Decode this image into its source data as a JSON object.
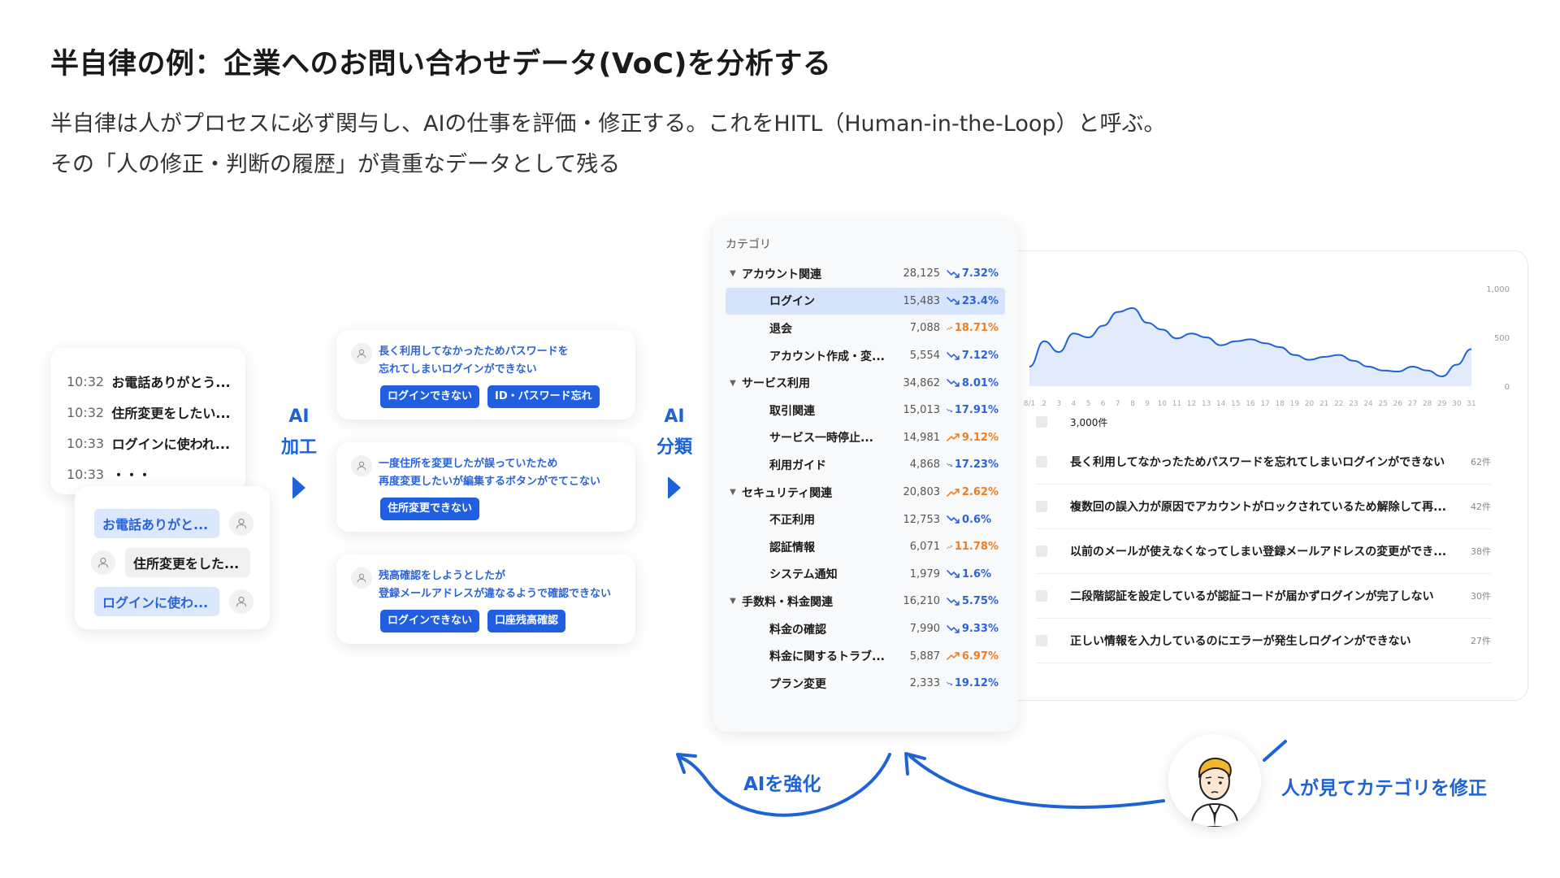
{
  "title": "半自律の例：企業へのお問い合わせデータ(VoC)を分析する",
  "subtitle_lines": [
    "半自律は人がプロセスに必ず関与し、AIの仕事を評価・修正する。これをHITL（Human-in-the-Loop）と呼ぶ。",
    "その「人の修正・判断の履歴」が貴重なデータとして残る"
  ],
  "transcript": [
    {
      "time": "10:32",
      "text": "お電話ありがとう..."
    },
    {
      "time": "10:32",
      "text": "住所変更をしたい..."
    },
    {
      "time": "10:33",
      "text": "ログインに使われ..."
    },
    {
      "time": "10:33",
      "text": "・・・"
    }
  ],
  "bubbles": [
    {
      "text": "お電話ありがと...",
      "side": "left",
      "style": "blue"
    },
    {
      "text": "住所変更をした...",
      "side": "right",
      "style": "gray"
    },
    {
      "text": "ログインに使わ...",
      "side": "left",
      "style": "blue"
    }
  ],
  "flow_labels": {
    "process_line1": "AI",
    "process_line2": "加工",
    "classify_line1": "AI",
    "classify_line2": "分類"
  },
  "inquiries": [
    {
      "text": [
        "長く利用してなかったためパスワードを",
        "忘れてしまいログインができない"
      ],
      "tags": [
        "ログインできない",
        "ID・パスワード忘れ"
      ]
    },
    {
      "text": [
        "一度住所を変更したが誤っていたため",
        "再度変更したいが編集するボタンがでてこない"
      ],
      "tags": [
        "住所変更できない"
      ]
    },
    {
      "text": [
        "残高確認をしようとしたが",
        "登録メールアドレスが違なるようで確認できない"
      ],
      "tags": [
        "ログインできない",
        "口座残高確認"
      ]
    }
  ],
  "category_panel": {
    "header": "カテゴリ",
    "rows": [
      {
        "name": "アカウント関連",
        "level": "parent",
        "count": "28,125",
        "pct": "7.32%",
        "dir": "down"
      },
      {
        "name": "ログイン",
        "level": "child",
        "count": "15,483",
        "pct": "23.4%",
        "dir": "down",
        "selected": true
      },
      {
        "name": "退会",
        "level": "child",
        "count": "7,088",
        "pct": "18.71%",
        "dir": "up"
      },
      {
        "name": "アカウント作成・変...",
        "level": "child",
        "count": "5,554",
        "pct": "7.12%",
        "dir": "down"
      },
      {
        "name": "サービス利用",
        "level": "parent",
        "count": "34,862",
        "pct": "8.01%",
        "dir": "down"
      },
      {
        "name": "取引関連",
        "level": "child",
        "count": "15,013",
        "pct": "17.91%",
        "dir": "down"
      },
      {
        "name": "サービス一時停止...",
        "level": "child",
        "count": "14,981",
        "pct": "9.12%",
        "dir": "up"
      },
      {
        "name": "利用ガイド",
        "level": "child",
        "count": "4,868",
        "pct": "17.23%",
        "dir": "down"
      },
      {
        "name": "セキュリティ関連",
        "level": "parent",
        "count": "20,803",
        "pct": "2.62%",
        "dir": "up"
      },
      {
        "name": "不正利用",
        "level": "child",
        "count": "12,753",
        "pct": "0.6%",
        "dir": "down"
      },
      {
        "name": "認証情報",
        "level": "child",
        "count": "6,071",
        "pct": "11.78%",
        "dir": "up"
      },
      {
        "name": "システム通知",
        "level": "child",
        "count": "1,979",
        "pct": "1.6%",
        "dir": "down"
      },
      {
        "name": "手数料・料金関連",
        "level": "parent",
        "count": "16,210",
        "pct": "5.75%",
        "dir": "down"
      },
      {
        "name": "料金の確認",
        "level": "child",
        "count": "7,990",
        "pct": "9.33%",
        "dir": "down"
      },
      {
        "name": "料金に関するトラブ...",
        "level": "child",
        "count": "5,887",
        "pct": "6.97%",
        "dir": "up"
      },
      {
        "name": "プラン変更",
        "level": "child",
        "count": "2,333",
        "pct": "19.12%",
        "dir": "down"
      }
    ]
  },
  "colors": {
    "accent": "#1e63d6",
    "tag_bg": "#1f5fe0",
    "up": "#ef7d22",
    "down": "#2b63d9",
    "selected_row": "#d6e4fb"
  },
  "chart_data": {
    "type": "area",
    "categories": [
      "8/1",
      "2",
      "3",
      "4",
      "5",
      "6",
      "7",
      "8",
      "9",
      "10",
      "11",
      "12",
      "13",
      "14",
      "15",
      "16",
      "17",
      "18",
      "19",
      "20",
      "21",
      "22",
      "23",
      "24",
      "25",
      "26",
      "27",
      "28",
      "29",
      "30",
      "31"
    ],
    "values": [
      200,
      460,
      350,
      540,
      500,
      620,
      760,
      800,
      650,
      580,
      490,
      540,
      500,
      420,
      460,
      480,
      440,
      400,
      320,
      270,
      300,
      320,
      260,
      200,
      160,
      150,
      200,
      160,
      100,
      220,
      380
    ],
    "ylim": [
      0,
      1000
    ],
    "yticks": [
      "1,000",
      "500",
      "0"
    ],
    "line_color": "#1e63d6",
    "fill_color": "#dbe6fa"
  },
  "list_panel": {
    "total": "3,000件",
    "items": [
      {
        "text": "長く利用してなかったためパスワードを忘れてしまいログインができない",
        "count": "62件"
      },
      {
        "text": "複数回の誤入力が原因でアカウントがロックされているため解除して再...",
        "count": "42件"
      },
      {
        "text": "以前のメールが使えなくなってしまい登録メールアドレスの変更ができ...",
        "count": "38件"
      },
      {
        "text": "二段階認証を設定しているが認証コードが届かずログインが完了しない",
        "count": "30件"
      },
      {
        "text": "正しい情報を入力しているのにエラーが発生しログインができない",
        "count": "27件"
      }
    ]
  },
  "bottom_labels": {
    "strengthen": "AIを強化",
    "human_fix": "人が見てカテゴリを修正"
  },
  "icons": {
    "user": "user-icon",
    "trend_down": "trend-down-icon",
    "trend_up": "trend-up-icon",
    "caret": "caret-down-icon",
    "person": "person-illustration"
  }
}
